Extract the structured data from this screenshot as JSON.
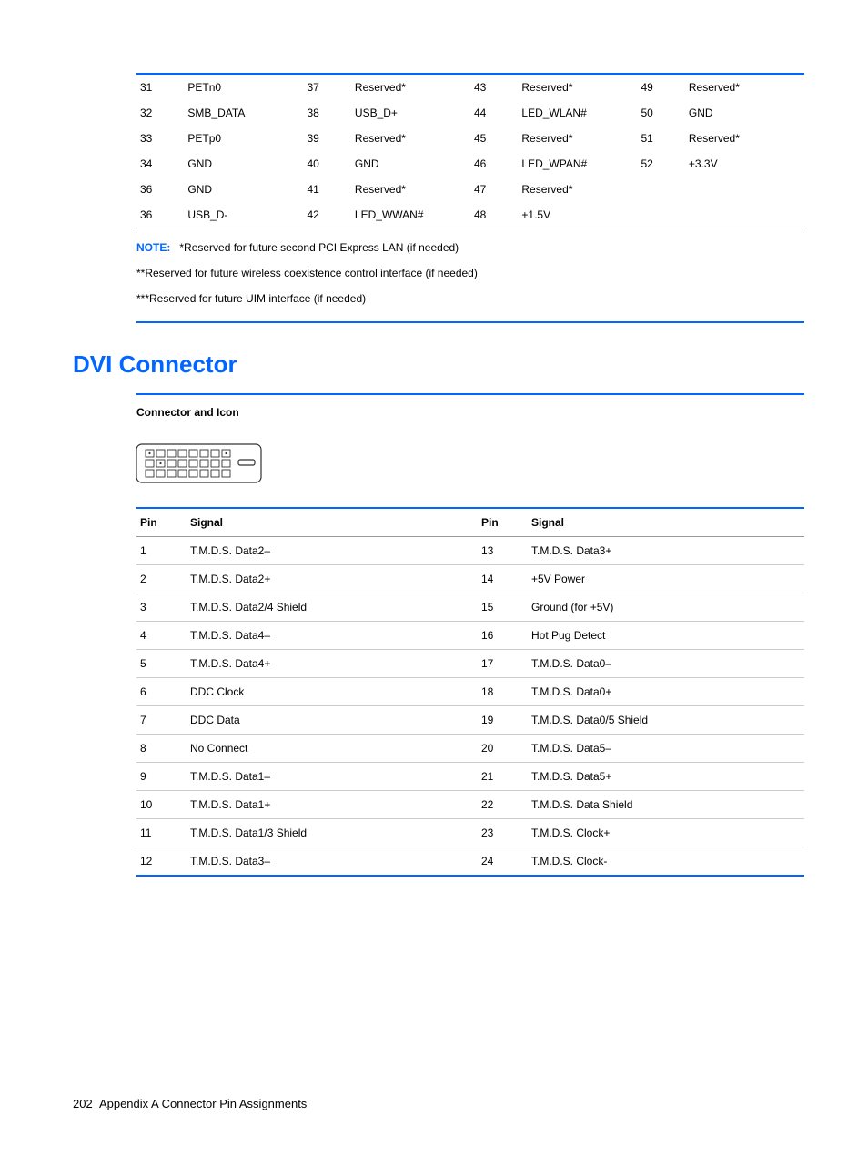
{
  "topPinRows": [
    {
      "c": [
        {
          "p": "31",
          "s": "PETn0"
        },
        {
          "p": "37",
          "s": "Reserved*"
        },
        {
          "p": "43",
          "s": "Reserved*"
        },
        {
          "p": "49",
          "s": "Reserved*"
        }
      ]
    },
    {
      "c": [
        {
          "p": "32",
          "s": "SMB_DATA"
        },
        {
          "p": "38",
          "s": "USB_D+"
        },
        {
          "p": "44",
          "s": "LED_WLAN#"
        },
        {
          "p": "50",
          "s": "GND"
        }
      ]
    },
    {
      "c": [
        {
          "p": "33",
          "s": "PETp0"
        },
        {
          "p": "39",
          "s": "Reserved*"
        },
        {
          "p": "45",
          "s": "Reserved*"
        },
        {
          "p": "51",
          "s": "Reserved*"
        }
      ]
    },
    {
      "c": [
        {
          "p": "34",
          "s": "GND"
        },
        {
          "p": "40",
          "s": "GND"
        },
        {
          "p": "46",
          "s": "LED_WPAN#"
        },
        {
          "p": "52",
          "s": "+3.3V"
        }
      ]
    },
    {
      "c": [
        {
          "p": "36",
          "s": "GND"
        },
        {
          "p": "41",
          "s": "Reserved*"
        },
        {
          "p": "47",
          "s": "Reserved*"
        },
        {
          "p": "",
          "s": ""
        }
      ]
    },
    {
      "c": [
        {
          "p": "36",
          "s": "USB_D-"
        },
        {
          "p": "42",
          "s": "LED_WWAN#"
        },
        {
          "p": "48",
          "s": "+1.5V"
        },
        {
          "p": "",
          "s": ""
        }
      ]
    }
  ],
  "note": {
    "label": "NOTE:",
    "line1": "*Reserved for future second PCI Express LAN (if needed)",
    "line2": "**Reserved for future wireless coexistence control interface (if needed)",
    "line3": "***Reserved for future UIM interface (if needed)"
  },
  "section": {
    "title": "DVI Connector",
    "subtitle": "Connector and Icon"
  },
  "dviHeaders": {
    "pin": "Pin",
    "signal": "Signal"
  },
  "dviRows": [
    {
      "p1": "1",
      "s1": "T.M.D.S. Data2–",
      "p2": "13",
      "s2": "T.M.D.S. Data3+"
    },
    {
      "p1": "2",
      "s1": "T.M.D.S. Data2+",
      "p2": "14",
      "s2": "+5V Power"
    },
    {
      "p1": "3",
      "s1": "T.M.D.S. Data2/4 Shield",
      "p2": "15",
      "s2": "Ground (for +5V)"
    },
    {
      "p1": "4",
      "s1": "T.M.D.S. Data4–",
      "p2": "16",
      "s2": "Hot Pug Detect"
    },
    {
      "p1": "5",
      "s1": "T.M.D.S. Data4+",
      "p2": "17",
      "s2": "T.M.D.S. Data0–"
    },
    {
      "p1": "6",
      "s1": "DDC Clock",
      "p2": "18",
      "s2": "T.M.D.S. Data0+"
    },
    {
      "p1": "7",
      "s1": "DDC Data",
      "p2": "19",
      "s2": "T.M.D.S. Data0/5 Shield"
    },
    {
      "p1": "8",
      "s1": "No Connect",
      "p2": "20",
      "s2": "T.M.D.S. Data5–"
    },
    {
      "p1": "9",
      "s1": "T.M.D.S. Data1–",
      "p2": "21",
      "s2": "T.M.D.S. Data5+"
    },
    {
      "p1": "10",
      "s1": "T.M.D.S. Data1+",
      "p2": "22",
      "s2": "T.M.D.S. Data Shield"
    },
    {
      "p1": "11",
      "s1": "T.M.D.S. Data1/3 Shield",
      "p2": "23",
      "s2": "T.M.D.S. Clock+"
    },
    {
      "p1": "12",
      "s1": "T.M.D.S. Data3–",
      "p2": "24",
      "s2": "T.M.D.S. Clock-"
    }
  ],
  "footer": {
    "pagenum": "202",
    "appendix": "Appendix A   Connector Pin Assignments"
  }
}
